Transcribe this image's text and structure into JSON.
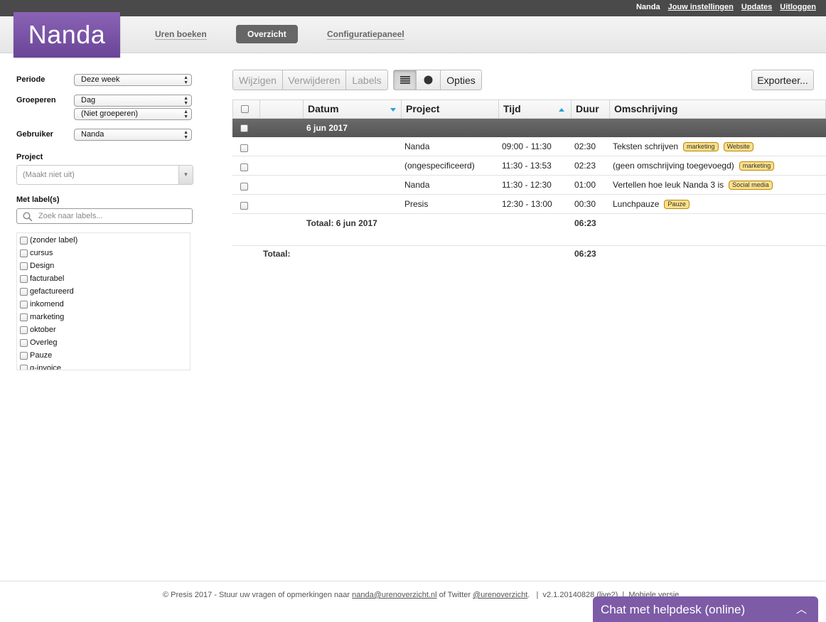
{
  "topbar": {
    "user": "Nanda",
    "links": [
      "Jouw instellingen",
      "Updates",
      "Uitloggen"
    ]
  },
  "header": {
    "logo": "Nanda",
    "nav": [
      "Uren boeken",
      "Overzicht",
      "Configuratiepaneel"
    ],
    "active_nav": "Overzicht"
  },
  "sidebar": {
    "periode_label": "Periode",
    "periode_value": "Deze week",
    "groeperen_label": "Groeperen",
    "groeperen_value1": "Dag",
    "groeperen_value2": "(Niet groeperen)",
    "gebruiker_label": "Gebruiker",
    "gebruiker_value": "Nanda",
    "project_label": "Project",
    "project_placeholder": "(Maakt niet uit)",
    "labels_label": "Met label(s)",
    "labels_search_placeholder": "Zoek naar labels...",
    "labels": [
      "(zonder label)",
      "cursus",
      "Design",
      "facturabel",
      "gefactureerd",
      "inkomend",
      "marketing",
      "oktober",
      "Overleg",
      "Pauze",
      "q-invoice"
    ]
  },
  "toolbar": {
    "wijzigen": "Wijzigen",
    "verwijderen": "Verwijderen",
    "labels": "Labels",
    "opties": "Opties",
    "exporteer": "Exporteer..."
  },
  "table": {
    "headers": {
      "datum": "Datum",
      "project": "Project",
      "tijd": "Tijd",
      "duur": "Duur",
      "omschrijving": "Omschrijving"
    },
    "group_title": "6 jun 2017",
    "rows": [
      {
        "project": "Nanda",
        "tijd": "09:00 - 11:30",
        "duur": "02:30",
        "omschrijving": "Teksten schrijven",
        "tags": [
          "marketing",
          "Website"
        ]
      },
      {
        "project": "(ongespecificeerd)",
        "tijd": "11:30 - 13:53",
        "duur": "02:23",
        "omschrijving": "(geen omschrijving toegevoegd)",
        "tags": [
          "marketing"
        ]
      },
      {
        "project": "Nanda",
        "tijd": "11:30 - 12:30",
        "duur": "01:00",
        "omschrijving": "Vertellen hoe leuk Nanda 3 is",
        "tags": [
          "Social media"
        ]
      },
      {
        "project": "Presis",
        "tijd": "12:30 - 13:00",
        "duur": "00:30",
        "omschrijving": "Lunchpauze",
        "tags": [
          "Pauze"
        ]
      }
    ],
    "group_total_label": "Totaal: 6 jun 2017",
    "group_total": "06:23",
    "total_label": "Totaal:",
    "total": "06:23"
  },
  "footer": {
    "text1": "© Presis 2017 - Stuur uw vragen of opmerkingen naar ",
    "email": "nanda@urenoverzicht.nl",
    "text2": " of Twitter ",
    "twitter": "@urenoverzicht",
    "text3": ".   |  v2.1.20140828 (live2)  |  ",
    "mobile": "Mobiele versie"
  },
  "chat": {
    "label": "Chat met helpdesk (online)"
  },
  "colors": {
    "brand": "#7d5ba6",
    "tag": "#fbe08a",
    "sort": "#2a9fd6"
  }
}
